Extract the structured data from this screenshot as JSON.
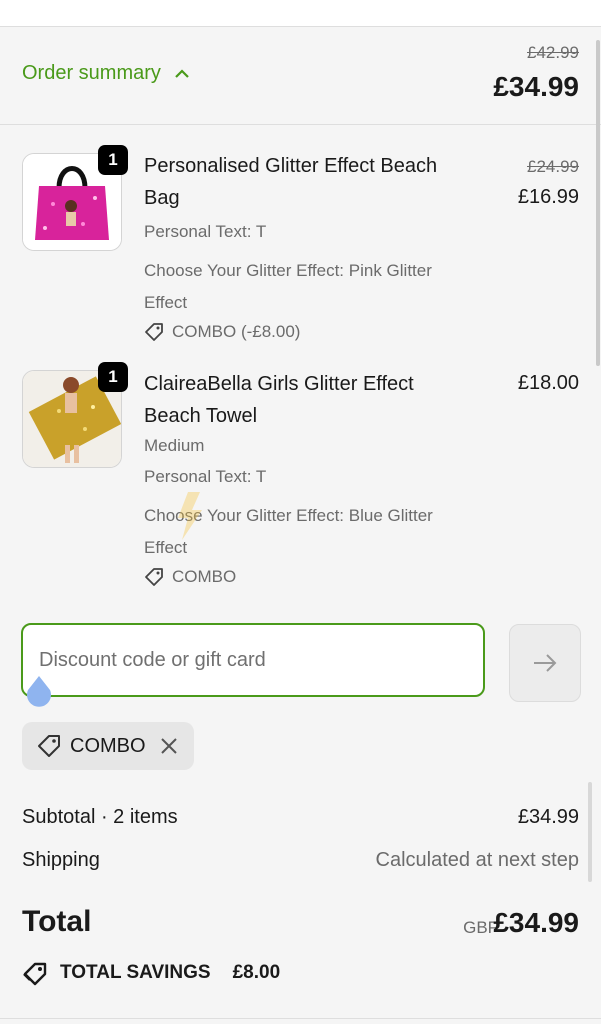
{
  "header": {
    "summary_label": "Order summary",
    "original_total": "£42.99",
    "total": "£34.99"
  },
  "items": [
    {
      "qty": "1",
      "title": "Personalised Glitter Effect Beach Bag",
      "lines": [
        "Personal Text: T",
        "Choose Your Glitter Effect: Pink Glitter Effect"
      ],
      "discount": "COMBO (-£8.00)",
      "original_price": "£24.99",
      "price": "£16.99"
    },
    {
      "qty": "1",
      "title": "ClaireaBella Girls Glitter Effect Beach Towel",
      "lines": [
        "Medium",
        "Personal Text: T",
        "Choose Your Glitter Effect: Blue Glitter Effect"
      ],
      "discount": "COMBO",
      "price": "£18.00"
    }
  ],
  "discount_field": {
    "placeholder": "Discount code or gift card",
    "value": ""
  },
  "applied_code": "COMBO",
  "totals": {
    "subtotal_label": "Subtotal · 2 items",
    "subtotal": "£34.99",
    "shipping_label": "Shipping",
    "shipping": "Calculated at next step",
    "total_label": "Total",
    "currency": "GBP",
    "total": "£34.99",
    "savings_label": "TOTAL SAVINGS",
    "savings": "£8.00"
  },
  "colors": {
    "accent": "#4a9a1a",
    "text": "#1a1a1a",
    "muted": "#6b6b6b",
    "bg": "#f5f5f5"
  },
  "icons": [
    "chevron-up-icon",
    "tag-icon",
    "arrow-right-icon",
    "close-icon",
    "savings-tag-icon"
  ]
}
